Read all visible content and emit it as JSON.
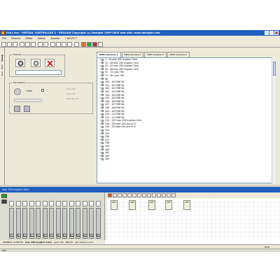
{
  "window": {
    "title": "live1.dvc - VIRTUAL CONTROLLER 2 - ENGLISH   Copyright (c) Daslight 1999-2005   web site: www.daslight.com"
  },
  "menu": [
    "File",
    "Fenetre",
    "Effets",
    "Option",
    "Spooler",
    "? HELP3 ?"
  ],
  "left_tabs": [
    "Setup",
    "Scan",
    "Live"
  ],
  "fixtures_group": {
    "label": "Fixtures"
  },
  "parameters_group": {
    "label": "Parameters",
    "code_label": "Code",
    "options": [
      "Invert Pan",
      "Invert Tilt",
      "Swap Pan Tilt"
    ]
  },
  "universe_tabs": [
    "DMX universe 1",
    "DMX universe 2",
    "DMX universe 3",
    "DMX universe 4"
  ],
  "fixture_rows": [
    "1 - 24 mac 250 krypton 14ch",
    "15 - 28 mac 250 krypton 14ch",
    "29 - 42 mac 250 krypton 14ch",
    "43 - 56 mac 250 krypton 14ch",
    "57 - 72 cyan 700",
    "73 - 90 cyan 700",
    "96",
    "100 - 100 PAR 64",
    "101 - 101 PAR 64",
    "102 - 102 PAR 64",
    "103 - 103 PAR 64",
    "104 - 104 PAR 64",
    "105 - 105 PAR 64",
    "106 - 106 PAR 64",
    "107 - 107 PAR 64",
    "108 - 108 PAR 64",
    "109 - 109 PAR 64",
    "110 - 110 PAR 64",
    "111 - 111 PAR 64",
    "112 - 125 mac 250 krypton 14ch",
    "126 - 139 pbo 150 pro v2.0",
    "140 - 153 pbo 150 pro v2.0",
    "154",
    "155",
    "156",
    "157",
    "158",
    "159",
    "160",
    "161",
    "162",
    "163"
  ],
  "lower_title": "mac 250 krypton 14ch",
  "fader_numbers": [
    "1",
    "2",
    "3",
    "4",
    "5",
    "6",
    "7",
    "8",
    "9",
    "10",
    "11",
    "12",
    "13",
    "14"
  ],
  "fader_levels": [
    0.05,
    0.05,
    0.05,
    0.05,
    0.05,
    0.05,
    0.05,
    0.05,
    0.05,
    0.05,
    0.05,
    0.05,
    0.05,
    0.05
  ],
  "preset_boxes": [
    "OFF",
    "OFF",
    "OFF",
    "OFF",
    "OFF"
  ],
  "footer_tabs": [
    {
      "label": "GENERAL OUTPUTS",
      "active": false
    },
    {
      "label": "mac 250 krypton 14ch",
      "active": true
    },
    {
      "label": "cyan 700",
      "active": false
    },
    {
      "label": "PAR 64",
      "active": false
    },
    {
      "label": "pbo 150 pro v2.0",
      "active": false
    }
  ],
  "status": {
    "left": "",
    "right": "NUM"
  },
  "taskbar": {
    "text": "Pret"
  },
  "colors": {
    "title_bar": "#1f5fbf",
    "panel": "#ece9d8",
    "list_border": "#7f9db9"
  }
}
